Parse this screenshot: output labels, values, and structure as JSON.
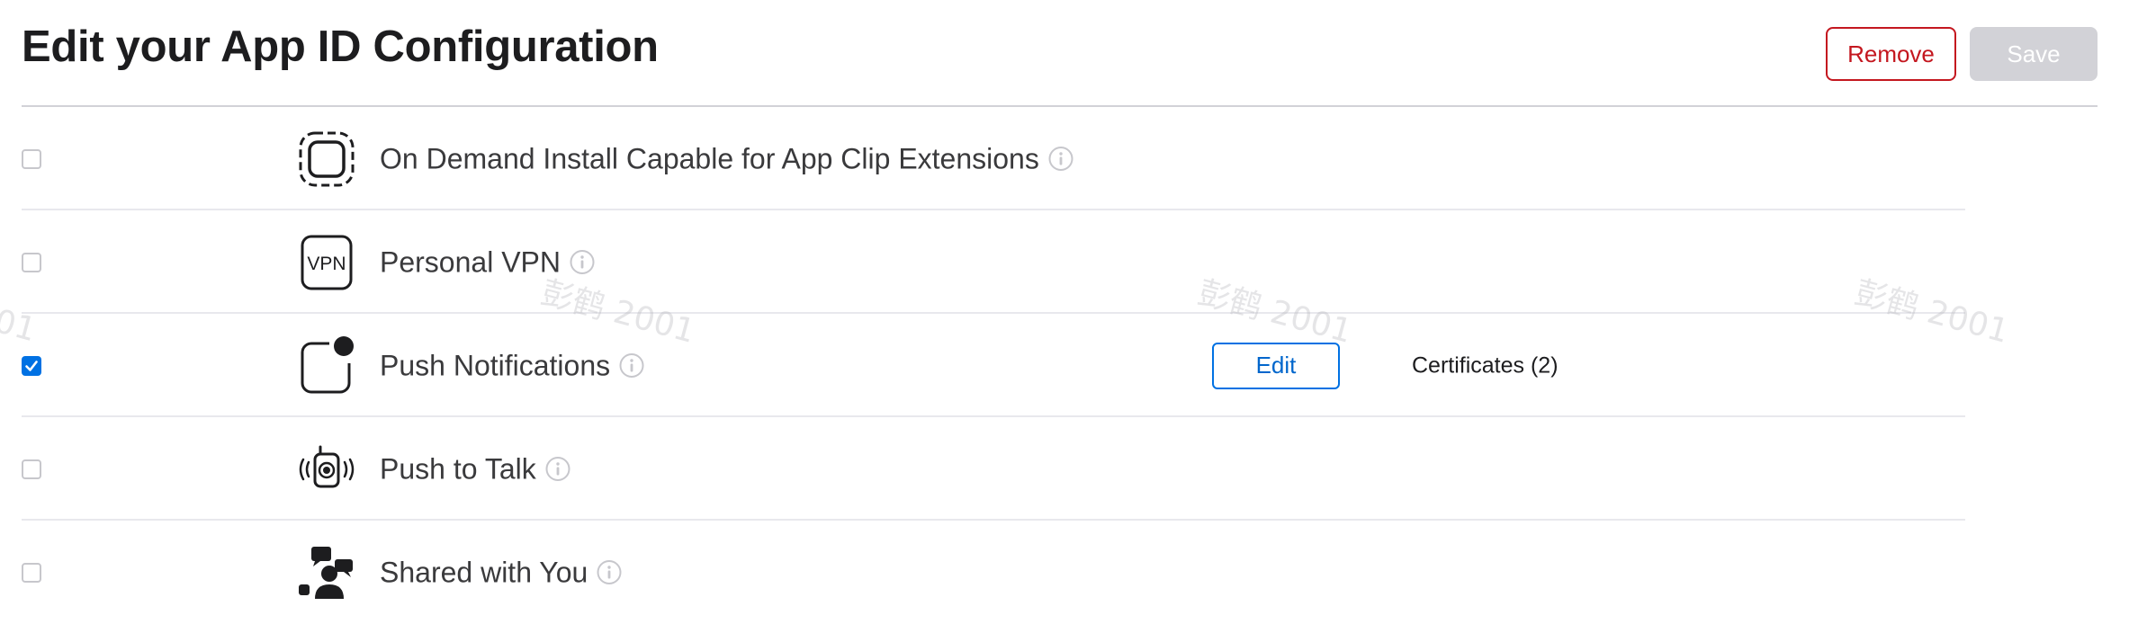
{
  "header": {
    "title": "Edit your App ID Configuration",
    "remove_label": "Remove",
    "save_label": "Save"
  },
  "capabilities": [
    {
      "label": "On Demand Install Capable for App Clip Extensions",
      "checked": false,
      "icon": "app-clip-icon"
    },
    {
      "label": "Personal VPN",
      "checked": false,
      "icon": "vpn-icon",
      "icon_text": "VPN"
    },
    {
      "label": "Push Notifications",
      "checked": true,
      "icon": "push-notifications-icon",
      "edit_label": "Edit",
      "status": "Certificates (2)"
    },
    {
      "label": "Push to Talk",
      "checked": false,
      "icon": "push-to-talk-icon"
    },
    {
      "label": "Shared with You",
      "checked": false,
      "icon": "shared-with-you-icon"
    }
  ],
  "watermarks": [
    "彭鹤 2001",
    "彭鹤 2001",
    "彭鹤 2001",
    "01"
  ],
  "colors": {
    "accent": "#0071e3",
    "destructive": "#c4171f",
    "disabled": "#d2d2d7"
  }
}
